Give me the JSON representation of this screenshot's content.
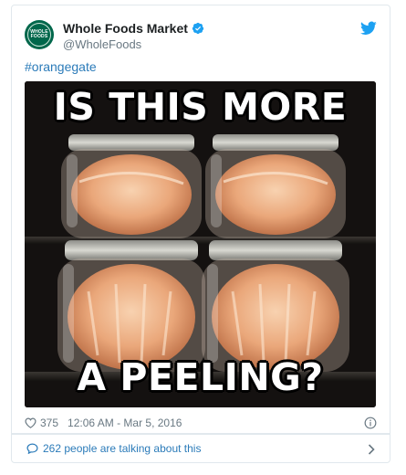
{
  "author": {
    "name": "Whole Foods Market",
    "handle": "@WholeFoods",
    "avatar_text": [
      "WHOLE",
      "FOODS"
    ],
    "verified": true
  },
  "tweet": {
    "text": "#orangegate"
  },
  "media": {
    "caption_top": "IS THIS MORE",
    "caption_bottom": "A PEELING?"
  },
  "meta": {
    "likes": "375",
    "timestamp": "12:06 AM - Mar 5, 2016"
  },
  "footer": {
    "conversation_label": "262 people are talking about this"
  },
  "icons": {
    "verified": "verified-badge-icon",
    "bird": "twitter-bird-icon",
    "heart": "heart-icon",
    "info": "info-icon",
    "bubble": "speech-bubble-icon",
    "chevron": "chevron-right-icon"
  },
  "colors": {
    "link": "#2b7bb9",
    "muted": "#697882",
    "brand_green": "#00674b",
    "twitter_blue": "#1da1f2"
  }
}
